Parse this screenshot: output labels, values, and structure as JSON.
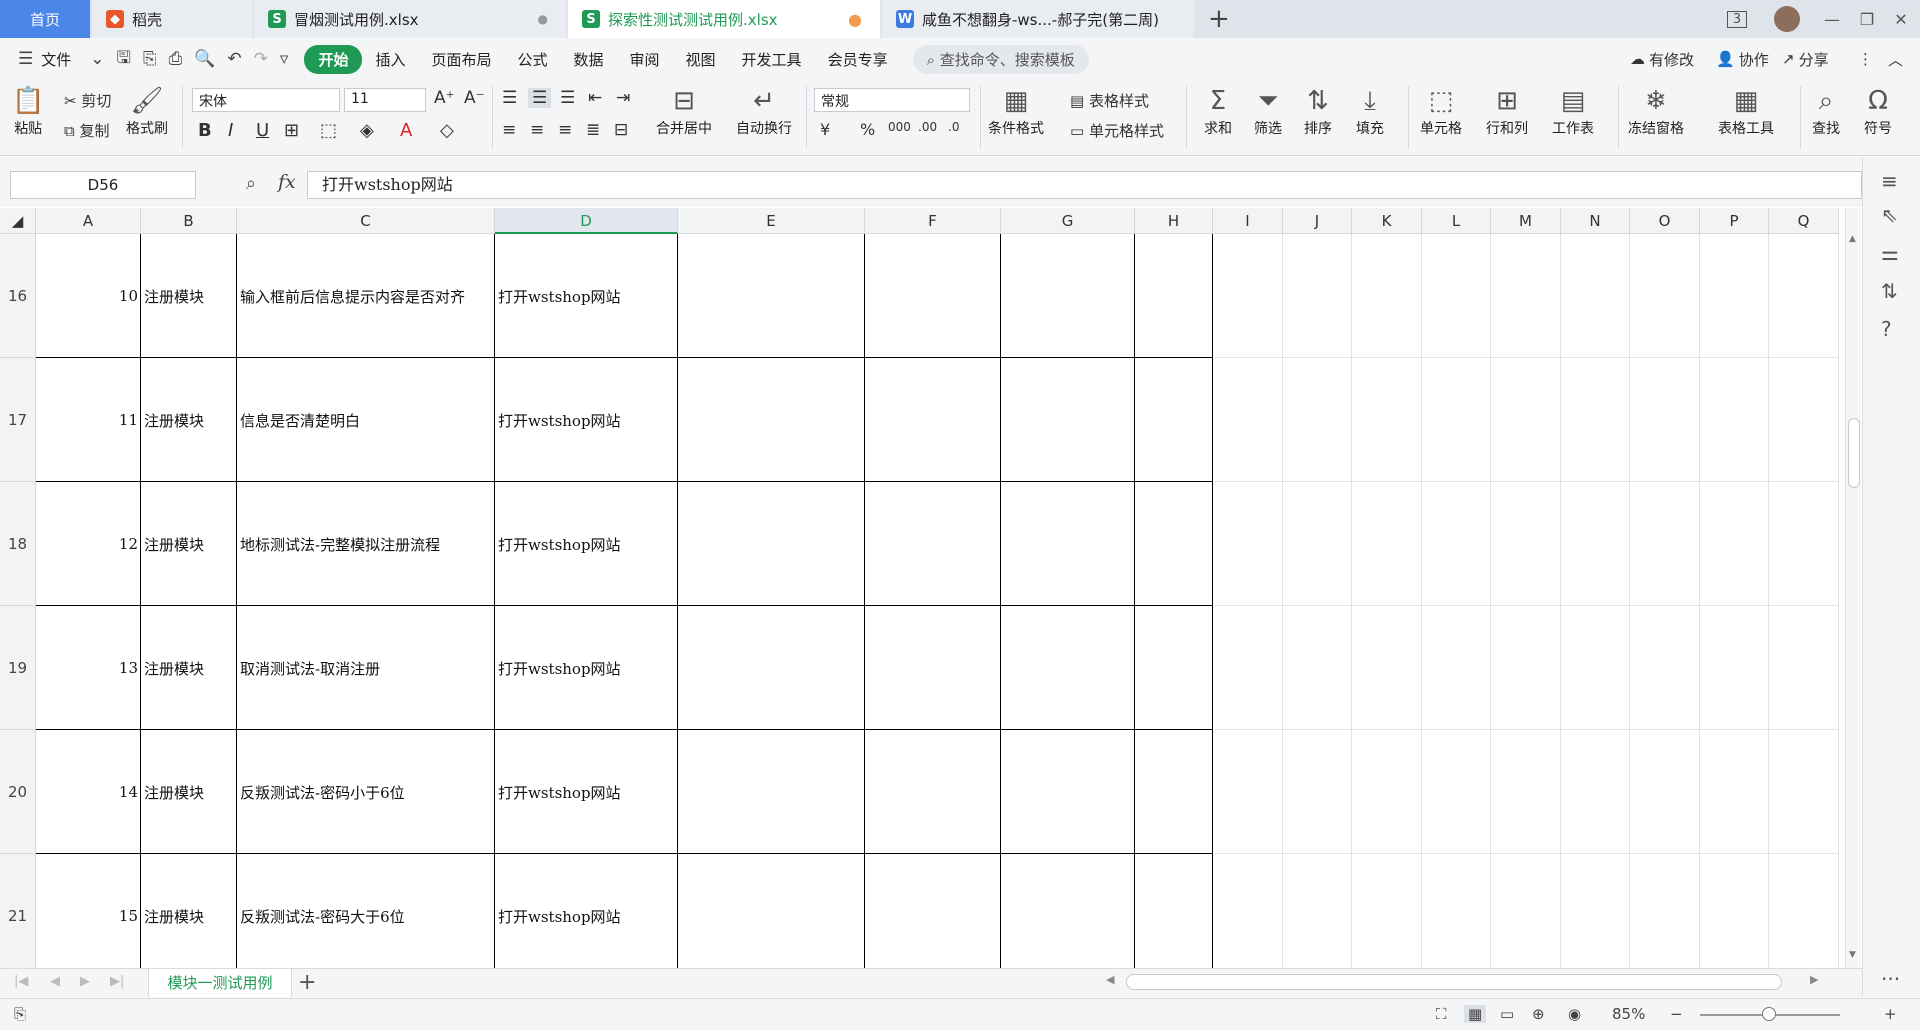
{
  "tabs": {
    "home": "首页",
    "t1": "稻壳",
    "t2": "冒烟测试用例.xlsx",
    "t3": "探索性测试测试用例.xlsx",
    "t4": "咸鱼不想翻身-ws...-郝子完(第二周)",
    "page_count": "3"
  },
  "menu": {
    "file": "文件",
    "items": [
      "开始",
      "插入",
      "页面布局",
      "公式",
      "数据",
      "审阅",
      "视图",
      "开发工具",
      "会员专享"
    ],
    "search": "查找命令、搜索模板",
    "right": [
      "有修改",
      "协作",
      "分享"
    ]
  },
  "ribbon": {
    "paste": "粘贴",
    "cut": "剪切",
    "copy": "复制",
    "format_painter": "格式刷",
    "font_name": "宋体",
    "font_size": "11",
    "merge": "合并居中",
    "wrap": "自动换行",
    "number_format": "常规",
    "cond_format": "条件格式",
    "table_style": "表格样式",
    "cell_style": "单元格样式",
    "sum": "求和",
    "filter": "筛选",
    "sort": "排序",
    "fill": "填充",
    "cell": "单元格",
    "rowcol": "行和列",
    "sheet": "工作表",
    "freeze": "冻结窗格",
    "table_tools": "表格工具",
    "find": "查找",
    "symbol": "符号"
  },
  "formula_bar": {
    "name_box": "D56",
    "fx": "fx",
    "content": "打开wstshop网站"
  },
  "columns": [
    "A",
    "B",
    "C",
    "D",
    "E",
    "F",
    "G",
    "H",
    "I",
    "J",
    "K",
    "L",
    "M",
    "N",
    "O",
    "P",
    "Q"
  ],
  "rows": [
    {
      "num": "16",
      "a": "10",
      "b": "注册模块",
      "c": "输入框前后信息提示内容是否对齐",
      "d": "打开wstshop网站"
    },
    {
      "num": "17",
      "a": "11",
      "b": "注册模块",
      "c": "信息是否清楚明白",
      "d": "打开wstshop网站"
    },
    {
      "num": "18",
      "a": "12",
      "b": "注册模块",
      "c": "地标测试法-完整模拟注册流程",
      "d": "打开wstshop网站"
    },
    {
      "num": "19",
      "a": "13",
      "b": "注册模块",
      "c": "取消测试法-取消注册",
      "d": "打开wstshop网站"
    },
    {
      "num": "20",
      "a": "14",
      "b": "注册模块",
      "c": "反叛测试法-密码小于6位",
      "d": "打开wstshop网站"
    },
    {
      "num": "21",
      "a": "15",
      "b": "注册模块",
      "c": "反叛测试法-密码大于6位",
      "d": "打开wstshop网站"
    }
  ],
  "sheet_tabs": [
    "模块一测试用例"
  ],
  "status": {
    "zoom": "85%"
  },
  "colors": {
    "accent": "#1f9a55",
    "home_tab": "#4a86e8"
  }
}
